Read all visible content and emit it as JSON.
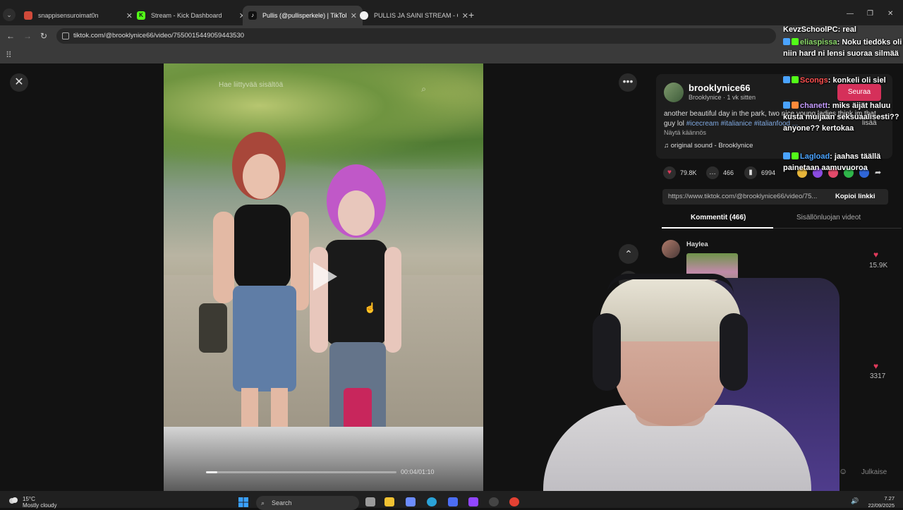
{
  "browser": {
    "tabs": [
      {
        "title": "snappisensuroimat0n",
        "active": false,
        "favicon_color": "#d04a3a"
      },
      {
        "title": "Stream - Kick Dashboard",
        "active": false,
        "favicon_color": "#53fc18"
      },
      {
        "title": "Pullis (@pullisperkele) | TikTok",
        "active": true,
        "favicon_color": "#111111"
      },
      {
        "title": "PULLIS JA SAINI STREAM - Goo",
        "active": false,
        "favicon_color": "#f2f2f2"
      }
    ],
    "new_tab": "+",
    "url": "tiktok.com/@brooklynice66/video/7550015449059443530"
  },
  "video": {
    "search_placeholder": "Hae liittyvää sisältöä",
    "timecode": "00:04/01:10",
    "progress": 0.06
  },
  "post": {
    "author": "brooklynice66",
    "author_sub": "Brooklynice · 1 vk sitten",
    "follow_label": "Seuraa",
    "description_text": "another beautiful day in the park, two nice young ladies think im that guy lol ",
    "tags": "#icecream #italianice #italianfood ...",
    "more_label": "lisää",
    "translate_label": "Näytä käännös",
    "sound_label": "original sound - Brooklynice",
    "likes": "79.8K",
    "comments": "466",
    "saves": "6994",
    "link": "https://www.tiktok.com/@brooklynice66/video/75...",
    "copy_link_label": "Kopioi linkki",
    "tab_comments": "Kommentit (466)",
    "tab_creator_videos": "Sisällönluojan videot",
    "comment_author": "Haylea",
    "comment_likes": "15.9K",
    "comment2_likes": "3317",
    "publish_label": "Julkaise"
  },
  "chat": [
    {
      "user": "KevzSchoolPC",
      "text": " real",
      "color": "#ffffff"
    },
    {
      "user": "eliaspissa",
      "text": " Noku tiedöks oli niin hard ni lensi suoraa silmää",
      "color": "#8bd86a"
    },
    {
      "user": "Scongs",
      "text": " konkeli oli siel",
      "color": "#ff4f4f"
    },
    {
      "user": "chanett",
      "text": " miks äijät haluu kusta muijaan seksuaalisesti?? anyone?? kertokaa",
      "color": "#c59cff"
    },
    {
      "user": "Lagload",
      "text": " jaahas täällä painetaan aamuvuoroa",
      "color": "#4aa3ff"
    }
  ],
  "taskbar": {
    "temperature": "15°C",
    "weather": "Mostly cloudy",
    "search_label": "Search",
    "time": "7.27",
    "date": "22/09/2025"
  }
}
